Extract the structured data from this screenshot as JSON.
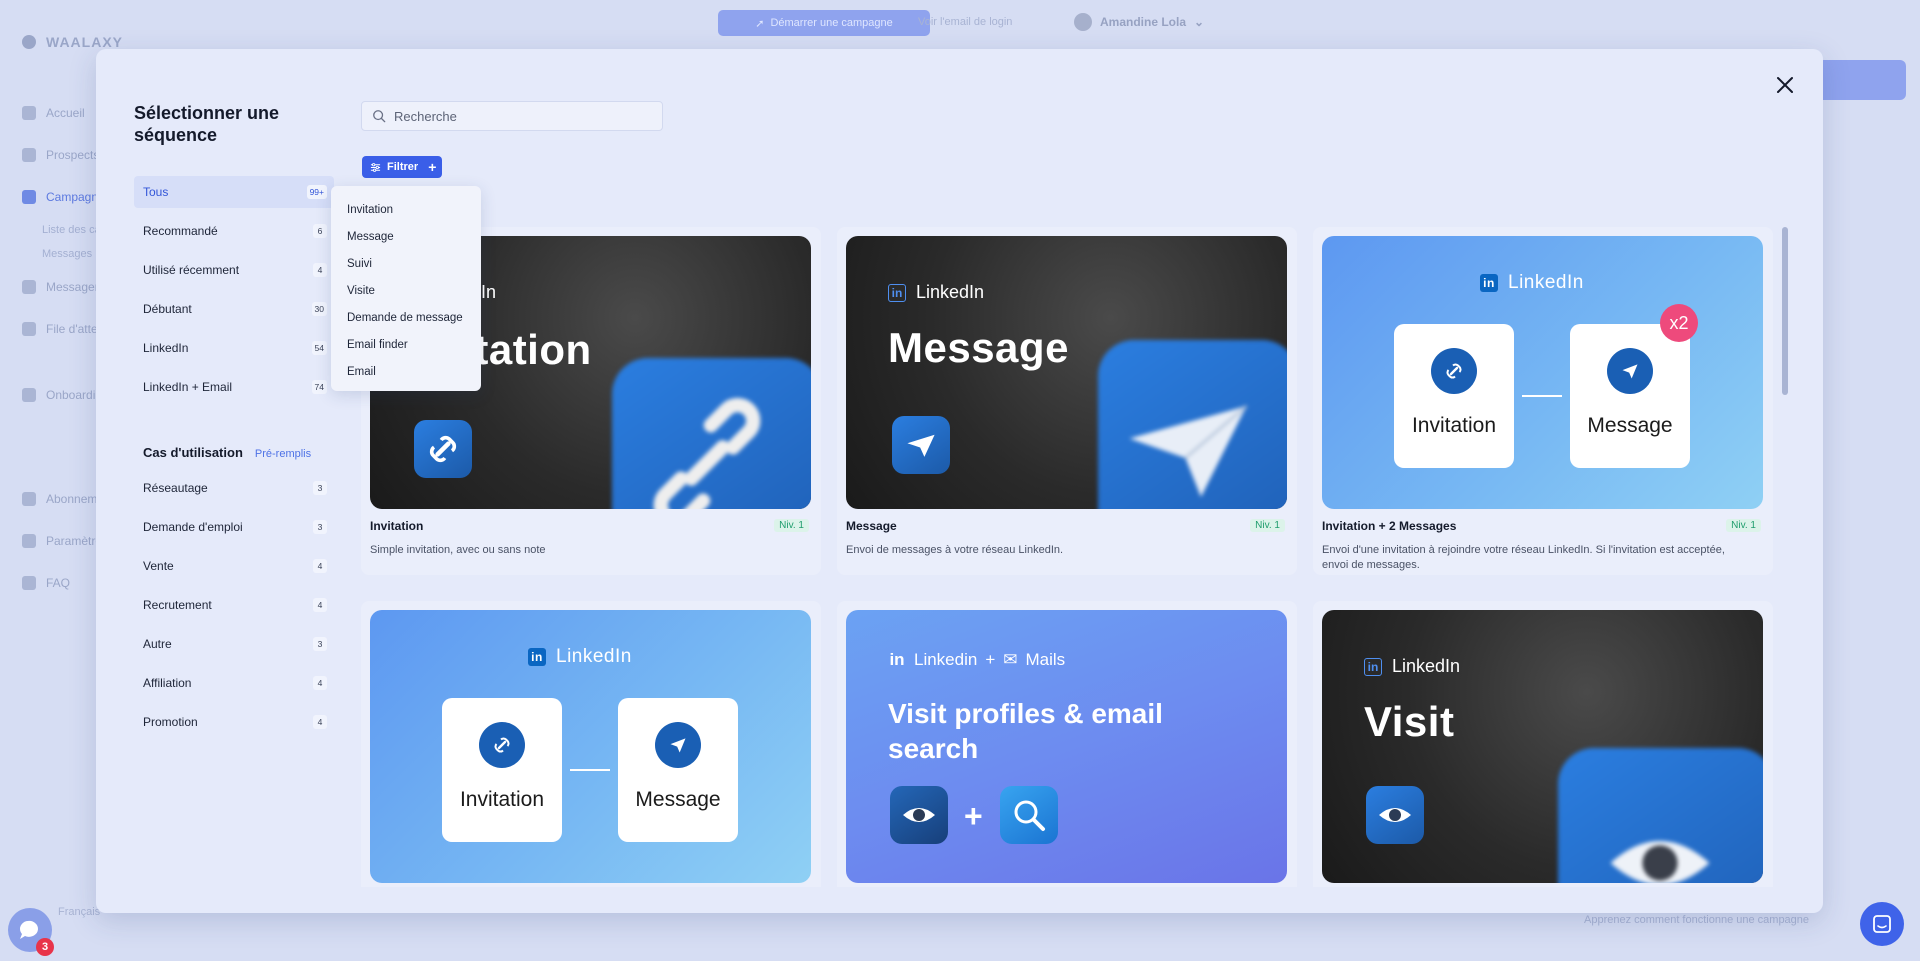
{
  "background": {
    "brand": "WAALAXY",
    "nav": [
      "Accueil",
      "Prospects",
      "Campagnes",
      "Messagerie",
      "File d'attente",
      "Onboarding",
      "Abonnement",
      "Paramètres",
      "FAQ"
    ],
    "subnav": [
      "Liste des campagnes",
      "Messages"
    ],
    "top_button": "Démarrer une campagne",
    "top_text": "Voir l'email de login",
    "user_name": "Amandine Lola",
    "footer_lang": "Français",
    "footer_help": "Apprenez comment fonctionne une campagne"
  },
  "modal": {
    "title": "Sélectionner une séquence",
    "search_placeholder": "Recherche",
    "filter_label": "Filtrer",
    "categories": [
      {
        "label": "Tous",
        "count": "99+",
        "active": true
      },
      {
        "label": "Recommandé",
        "count": "6"
      },
      {
        "label": "Utilisé récemment",
        "count": "4"
      },
      {
        "label": "Débutant",
        "count": "30"
      },
      {
        "label": "LinkedIn",
        "count": "54"
      },
      {
        "label": "LinkedIn + Email",
        "count": "74"
      }
    ],
    "usecase_title": "Cas d'utilisation",
    "usecase_link": "Pré-remplis",
    "usecases": [
      {
        "label": "Réseautage",
        "count": "3"
      },
      {
        "label": "Demande d'emploi",
        "count": "3"
      },
      {
        "label": "Vente",
        "count": "4"
      },
      {
        "label": "Recrutement",
        "count": "4"
      },
      {
        "label": "Autre",
        "count": "3"
      },
      {
        "label": "Affiliation",
        "count": "4"
      },
      {
        "label": "Promotion",
        "count": "4"
      }
    ],
    "filter_menu": [
      "Invitation",
      "Message",
      "Suivi",
      "Visite",
      "Demande de message",
      "Email finder",
      "Email"
    ],
    "cards": [
      {
        "img_title": "Invitation",
        "img_brand": "LinkedIn",
        "title": "Invitation",
        "level": "Niv. 1",
        "desc": "Simple invitation, avec ou sans note"
      },
      {
        "img_title": "Message",
        "img_brand": "LinkedIn",
        "title": "Message",
        "level": "Niv. 1",
        "desc": "Envoi de messages à votre réseau LinkedIn."
      },
      {
        "img_brand": "LinkedIn",
        "left_label": "Invitation",
        "right_label": "Message",
        "badge": "x2",
        "title": "Invitation + 2 Messages",
        "level": "Niv. 1",
        "desc": "Envoi d'une invitation à rejoindre votre réseau LinkedIn. Si l'invitation est acceptée, envoi de messages."
      },
      {
        "img_brand": "LinkedIn",
        "left_label": "Invitation",
        "right_label": "Message"
      },
      {
        "img_brand": "Linkedin",
        "img_brand2": "Mails",
        "img_title": "Visit profiles & email search"
      },
      {
        "img_brand": "LinkedIn",
        "img_title": "Visit"
      }
    ]
  },
  "floating": {
    "chat_badge": "3"
  },
  "colors": {
    "accent": "#3a5ee8",
    "level_green": "#1f9d6d",
    "modal_bg": "#e5eafa",
    "linkedin_blue": "#0a66c2",
    "badge_pink": "#ee4a7c",
    "chat_badge_red": "#e8344a"
  }
}
